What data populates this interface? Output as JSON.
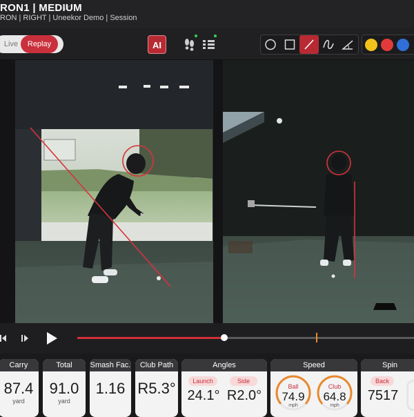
{
  "header": {
    "title": "RON1 | MEDIUM",
    "subtitle": "RON | RIGHT | Uneekor Demo | Session"
  },
  "toolbar": {
    "live_label": "Live",
    "replay_label": "Replay",
    "ai_label": "AI",
    "draw_tools": [
      "circle-tool",
      "square-tool",
      "line-tool",
      "curve-tool",
      "angle-tool"
    ],
    "active_tool": "line-tool",
    "colors": [
      "#f2c21b",
      "#e23a3a",
      "#2f6fd6"
    ]
  },
  "playback": {
    "progress": 0.437,
    "marker": 0.708
  },
  "metrics": {
    "carry": {
      "label": "Carry",
      "value": "87.4",
      "unit": "yard"
    },
    "total": {
      "label": "Total",
      "value": "91.0",
      "unit": "yard"
    },
    "smash": {
      "label": "Smash Fac.",
      "value": "1.16"
    },
    "club_path": {
      "label": "Club Path",
      "value": "R5.3°"
    },
    "angles": {
      "label": "Angles",
      "launch_label": "Launch",
      "launch_value": "24.1°",
      "side_label": "Side",
      "side_value": "R2.0°"
    },
    "speed": {
      "label": "Speed",
      "ball_label": "Ball",
      "ball_value": "74.9",
      "ball_unit": "mph",
      "club_label": "Club",
      "club_value": "64.8",
      "club_unit": "mph"
    },
    "spin": {
      "label": "Spin",
      "back_label": "Back",
      "back_value": "7517"
    }
  }
}
